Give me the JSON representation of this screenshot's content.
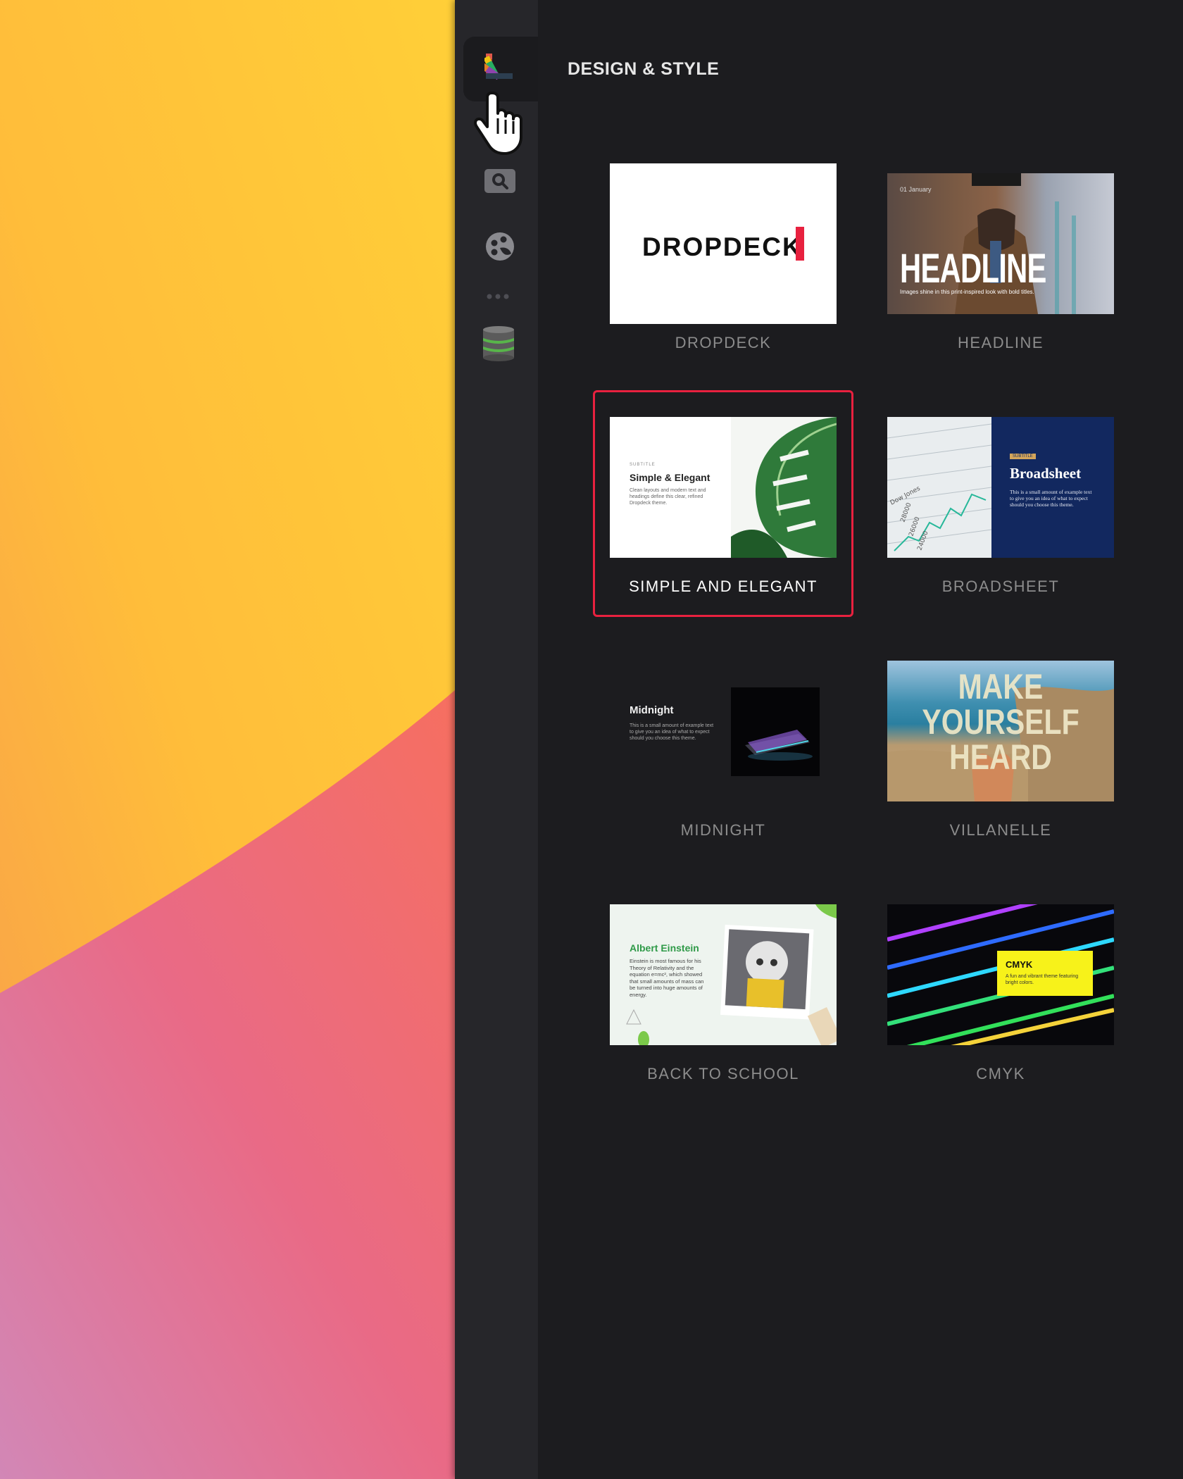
{
  "colors": {
    "selection": "#e8213f",
    "panel_bg": "#1c1c1f",
    "rail_bg": "#26262a"
  },
  "sidebar": {
    "items": [
      {
        "icon": "swatch-palette-icon",
        "active": true
      },
      {
        "icon": "search-icon",
        "active": false
      },
      {
        "icon": "face-icon",
        "active": false
      },
      {
        "icon": "more-icon",
        "active": false
      },
      {
        "icon": "database-icon",
        "active": false
      }
    ]
  },
  "panel": {
    "title": "DESIGN & STYLE",
    "themes": [
      {
        "label": "DROPDECK",
        "selected": false,
        "preview": {
          "text": "DROPDECK"
        }
      },
      {
        "label": "HEADLINE",
        "selected": false,
        "preview": {
          "date": "01 January",
          "title": "HEADLINE",
          "caption": "Images shine in this print-inspired look with bold titles."
        }
      },
      {
        "label": "SIMPLE AND ELEGANT",
        "selected": true,
        "preview": {
          "eyebrow": "SUBTITLE",
          "title": "Simple & Elegant",
          "body": "Clean layouts and modern text and headings define this clear, refined Dropdeck theme."
        }
      },
      {
        "label": "BROADSHEET",
        "selected": false,
        "preview": {
          "badge": "SUBTITLE",
          "title": "Broadsheet",
          "body": "This is a small amount of example text to give you an idea of what to expect should you choose this theme."
        }
      },
      {
        "label": "MIDNIGHT",
        "selected": false,
        "preview": {
          "title": "Midnight",
          "body": "This is a small amount of example text to give you an idea of what to expect should you choose this theme."
        }
      },
      {
        "label": "VILLANELLE",
        "selected": false,
        "preview": {
          "line1": "MAKE",
          "line2": "YOURSELF",
          "line3": "HEARD"
        }
      },
      {
        "label": "BACK TO SCHOOL",
        "selected": false,
        "preview": {
          "title": "Albert Einstein",
          "body": "Einstein is most famous for his Theory of Relativity and the equation e=mc², which showed that small amounts of mass can be turned into huge amounts of energy."
        }
      },
      {
        "label": "CMYK",
        "selected": false,
        "preview": {
          "title": "CMYK",
          "body": "A fun and vibrant theme featuring bright colors."
        }
      }
    ]
  }
}
